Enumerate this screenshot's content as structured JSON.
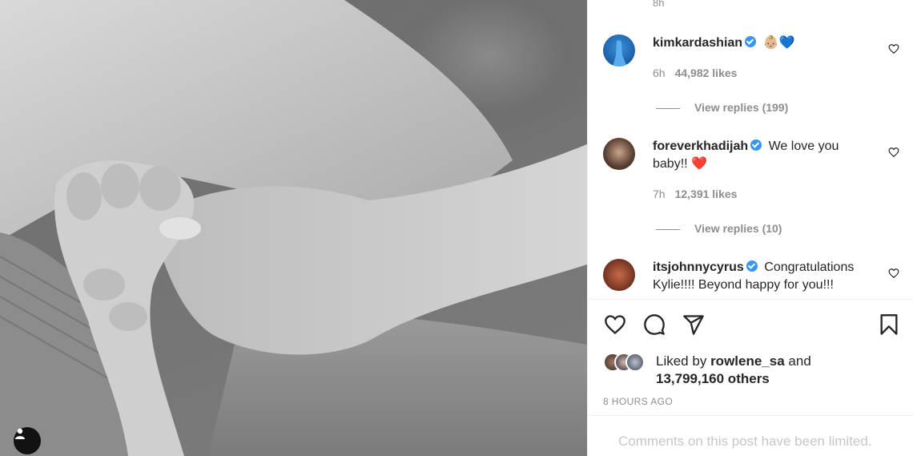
{
  "top_time": "8h",
  "comments": [
    {
      "username": "kimkardashian",
      "verified": true,
      "text": "👶🏼💙",
      "time": "6h",
      "likes": "44,982 likes",
      "replies": "View replies (199)"
    },
    {
      "username": "foreverkhadijah",
      "verified": true,
      "text": "We love you baby!! ❤️",
      "time": "7h",
      "likes": "12,391 likes",
      "replies": "View replies (10)"
    },
    {
      "username": "itsjohnnycyrus",
      "verified": true,
      "text": "Congratulations Kylie!!!! Beyond happy for you!!!"
    }
  ],
  "liked_by": {
    "prefix": "Liked by",
    "user": "rowlene_sa",
    "conj": "and",
    "others": "13,799,160 others"
  },
  "posted_ago": "8 HOURS AGO",
  "comments_limited": "Comments on this post have been limited.",
  "icons": {
    "like": "heart-icon",
    "comment": "comment-icon",
    "share": "send-icon",
    "save": "bookmark-icon",
    "tag": "user-tag-icon"
  }
}
